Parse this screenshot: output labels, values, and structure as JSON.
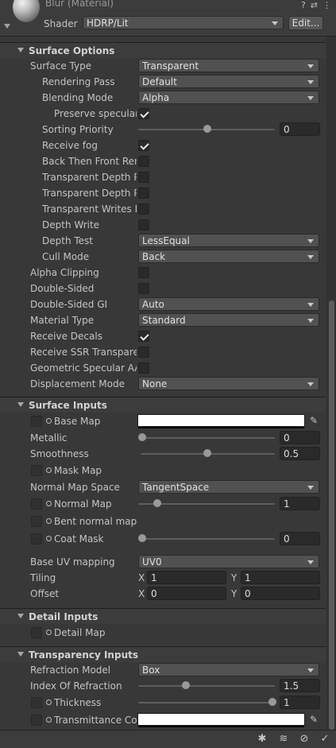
{
  "header": {
    "material_title": "Blur (Material)",
    "shader_label": "Shader",
    "shader_value": "HDRP/Lit",
    "edit_label": "Edit..."
  },
  "surface_options": {
    "title": "Surface Options",
    "surface_type": {
      "label": "Surface Type",
      "value": "Transparent"
    },
    "rendering_pass": {
      "label": "Rendering Pass",
      "value": "Default"
    },
    "blending_mode": {
      "label": "Blending Mode",
      "value": "Alpha"
    },
    "preserve_specular": {
      "label": "Preserve specular",
      "checked": true
    },
    "sorting_priority": {
      "label": "Sorting Priority",
      "value": "0",
      "slider_fraction": 0.5
    },
    "receive_fog": {
      "label": "Receive fog",
      "checked": true
    },
    "back_then_front": {
      "label": "Back Then Front Ren",
      "checked": false
    },
    "transparent_depth_pre": {
      "label": "Transparent Depth Pr",
      "checked": false
    },
    "transparent_depth_post": {
      "label": "Transparent Depth Po",
      "checked": false
    },
    "transparent_writes_motion": {
      "label": "Transparent Writes M",
      "checked": false
    },
    "depth_write": {
      "label": "Depth Write",
      "checked": false
    },
    "depth_test": {
      "label": "Depth Test",
      "value": "LessEqual"
    },
    "cull_mode": {
      "label": "Cull Mode",
      "value": "Back"
    },
    "alpha_clipping": {
      "label": "Alpha Clipping",
      "checked": false
    },
    "double_sided": {
      "label": "Double-Sided",
      "checked": false
    },
    "double_sided_gi": {
      "label": "Double-Sided GI",
      "value": "Auto"
    },
    "material_type": {
      "label": "Material Type",
      "value": "Standard"
    },
    "receive_decals": {
      "label": "Receive Decals",
      "checked": true
    },
    "receive_ssr": {
      "label": "Receive SSR Transpare",
      "checked": false
    },
    "geometric_specular_aa": {
      "label": "Geometric Specular AA",
      "checked": false
    },
    "displacement_mode": {
      "label": "Displacement Mode",
      "value": "None"
    }
  },
  "surface_inputs": {
    "title": "Surface Inputs",
    "base_map": {
      "label": "Base Map",
      "color": "#ffffff"
    },
    "metallic": {
      "label": "Metallic",
      "value": "0",
      "slider_fraction": 0.0
    },
    "smoothness": {
      "label": "Smoothness",
      "value": "0.5",
      "slider_fraction": 0.5
    },
    "mask_map": {
      "label": "Mask Map"
    },
    "normal_map_space": {
      "label": "Normal Map Space",
      "value": "TangentSpace"
    },
    "normal_map": {
      "label": "Normal Map",
      "value": "1",
      "slider_fraction": 0.125
    },
    "bent_normal_map": {
      "label": "Bent normal map"
    },
    "coat_mask": {
      "label": "Coat Mask",
      "value": "0",
      "slider_fraction": 0.0
    },
    "base_uv_mapping": {
      "label": "Base UV mapping",
      "value": "UV0"
    },
    "tiling": {
      "label": "Tiling",
      "x_label": "X",
      "x": "1",
      "y_label": "Y",
      "y": "1"
    },
    "offset": {
      "label": "Offset",
      "x_label": "X",
      "x": "0",
      "y_label": "Y",
      "y": "0"
    }
  },
  "detail_inputs": {
    "title": "Detail Inputs",
    "detail_map": {
      "label": "Detail Map"
    }
  },
  "transparency_inputs": {
    "title": "Transparency Inputs",
    "refraction_model": {
      "label": "Refraction Model",
      "value": "Box"
    },
    "index_of_refraction": {
      "label": "Index Of Refraction",
      "value": "1.5",
      "slider_fraction": 0.333
    },
    "thickness": {
      "label": "Thickness",
      "value": "1",
      "slider_fraction": 1.0
    },
    "transmittance_color": {
      "label": "Transmittance Col",
      "color": "#ffffff"
    }
  },
  "icons": {
    "help": "help-icon",
    "presets": "presets-icon",
    "more": "more-icon",
    "eyedropper": "eyedropper-icon",
    "footer": [
      "debug-icon",
      "layers-icon",
      "no-render-icon",
      "check-icon"
    ]
  }
}
